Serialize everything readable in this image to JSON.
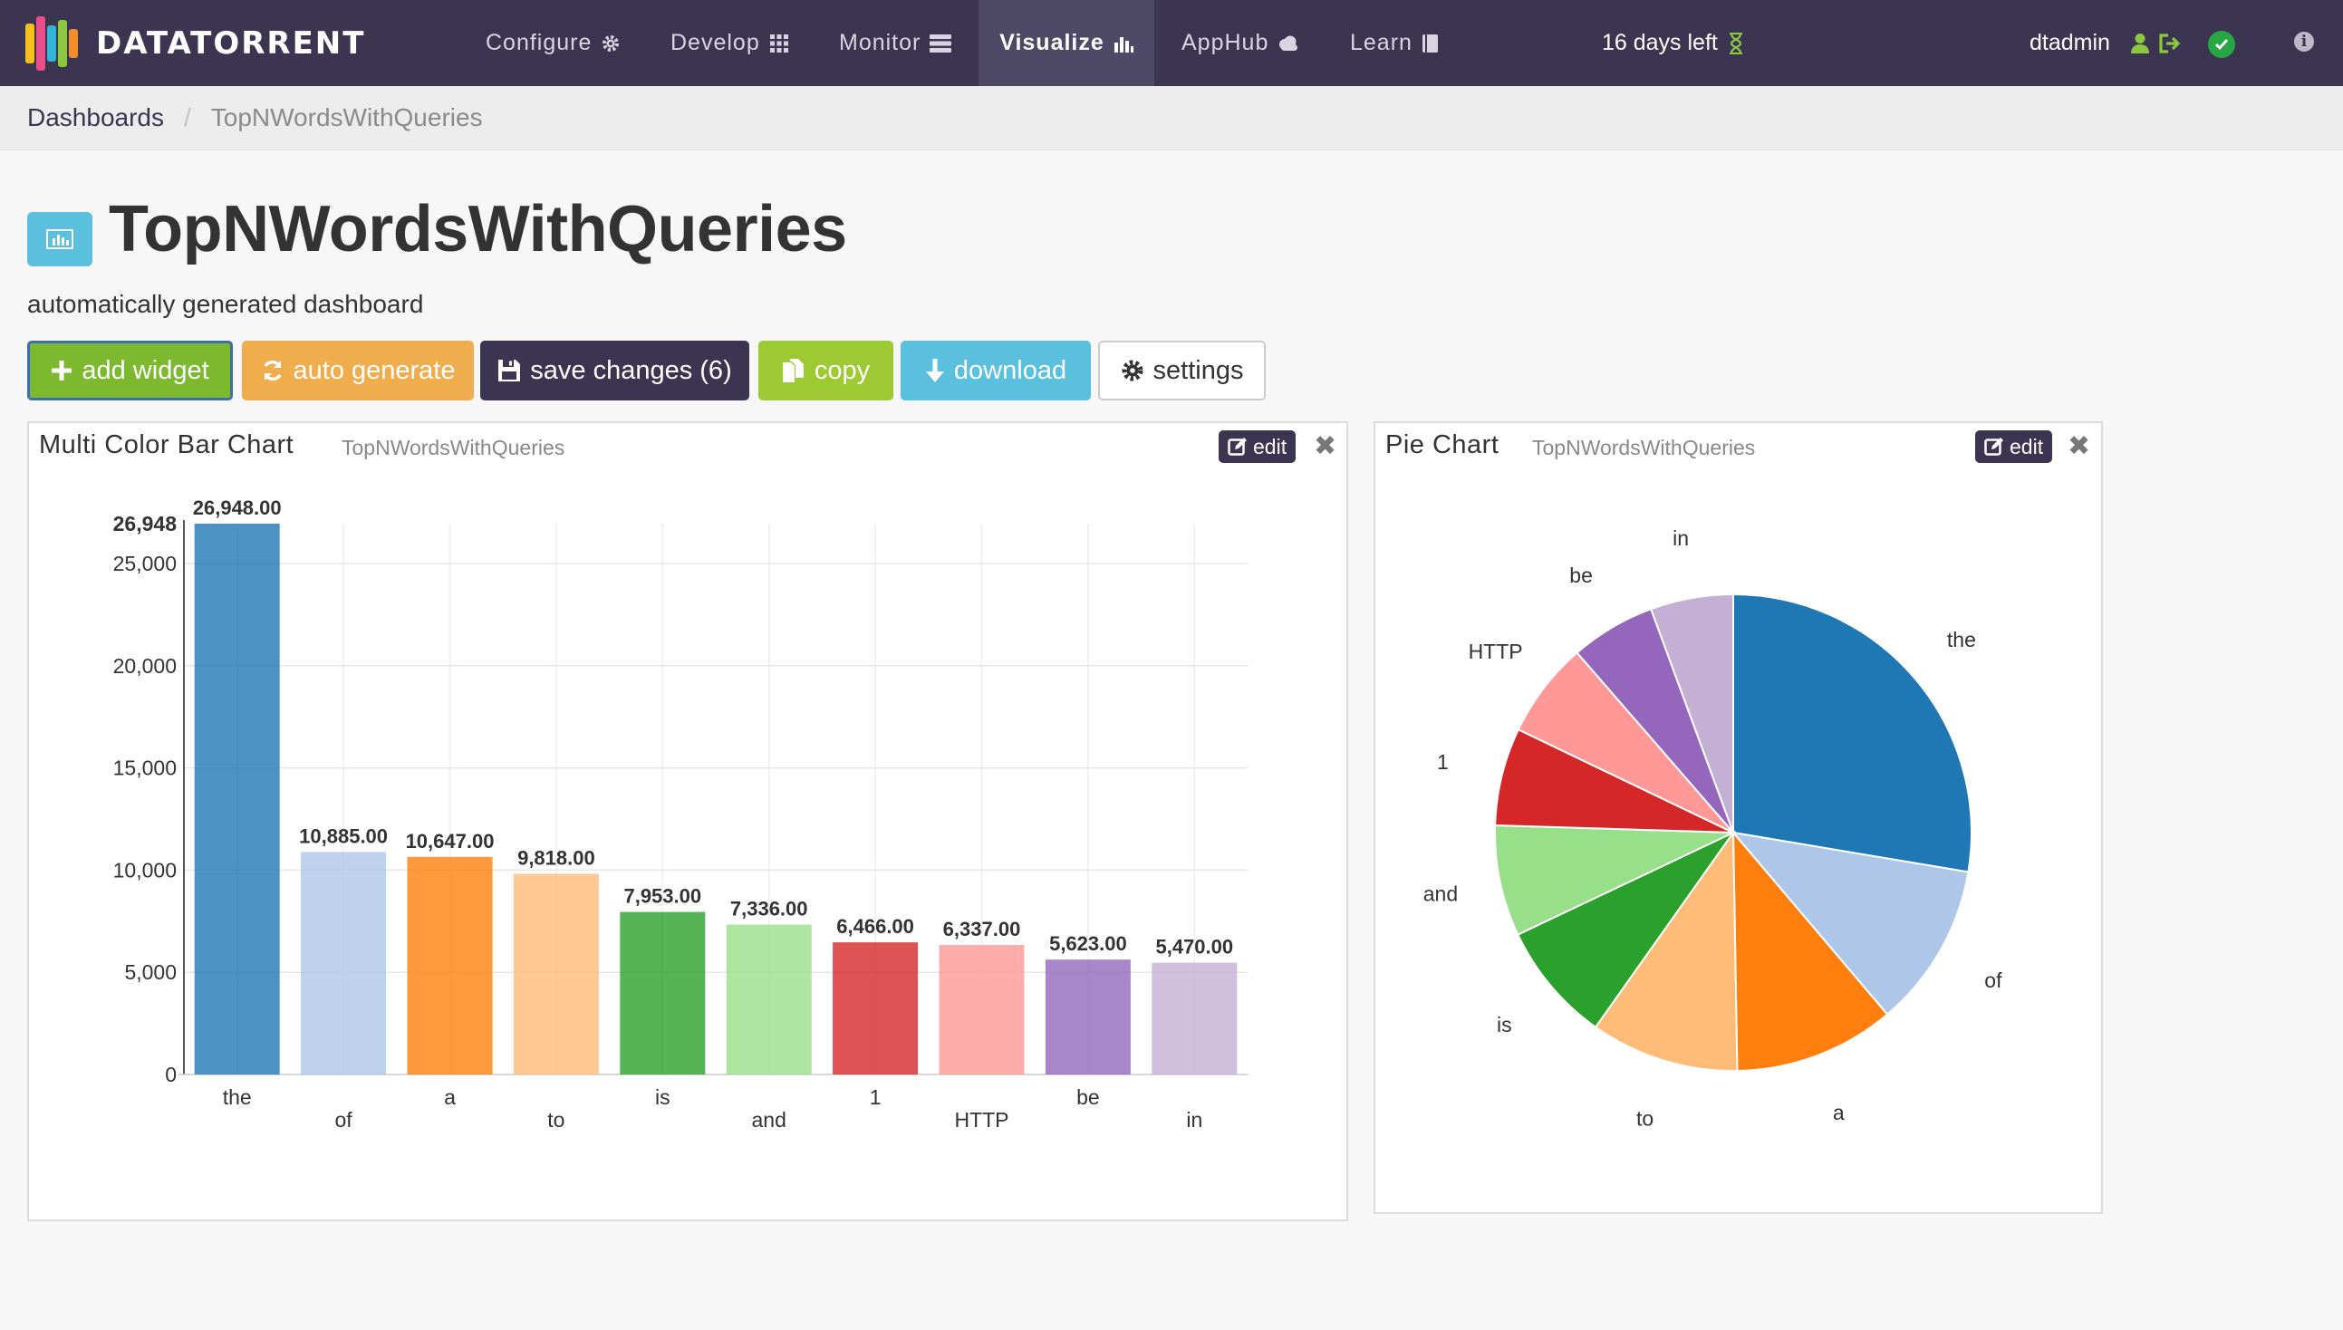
{
  "nav": {
    "brand": "DATATORRENT",
    "items": [
      {
        "label": "Configure",
        "icon": "gear-icon"
      },
      {
        "label": "Develop",
        "icon": "grid-icon"
      },
      {
        "label": "Monitor",
        "icon": "server-icon"
      },
      {
        "label": "Visualize",
        "icon": "bar-chart-icon",
        "active": true
      },
      {
        "label": "AppHub",
        "icon": "cloud-icon"
      },
      {
        "label": "Learn",
        "icon": "book-icon"
      }
    ],
    "trial": "16 days left",
    "user": "dtadmin"
  },
  "breadcrumb": {
    "root": "Dashboards",
    "separator": "/",
    "current": "TopNWordsWithQueries"
  },
  "page": {
    "title": "TopNWordsWithQueries",
    "subtitle": "automatically generated dashboard"
  },
  "toolbar": {
    "add_widget": "add widget",
    "auto_generate": "auto generate",
    "save_changes": "save changes (6)",
    "copy": "copy",
    "download": "download",
    "settings": "settings"
  },
  "widgets": {
    "bar": {
      "title": "Multi Color Bar Chart",
      "source": "TopNWordsWithQueries",
      "edit": "edit"
    },
    "pie": {
      "title": "Pie Chart",
      "source": "TopNWordsWithQueries",
      "edit": "edit"
    }
  },
  "colors": {
    "navbar": "#3b3551",
    "palette": [
      "#1f77b4",
      "#aec7e8",
      "#ff7f0e",
      "#ffbb78",
      "#2ca02c",
      "#98df8a",
      "#d62728",
      "#ff9896",
      "#9467bd",
      "#c5b0d5"
    ]
  },
  "chart_data": [
    {
      "type": "bar",
      "categories": [
        "the",
        "of",
        "a",
        "to",
        "is",
        "and",
        "1",
        "HTTP",
        "be",
        "in"
      ],
      "values": [
        26948,
        10885,
        10647,
        9818,
        7953,
        7336,
        6466,
        6337,
        5623,
        5470
      ],
      "data_labels": [
        "26,948.00",
        "10,885.00",
        "10,647.00",
        "9,818.00",
        "7,953.00",
        "7,336.00",
        "6,466.00",
        "6,337.00",
        "5,623.00",
        "5,470.00"
      ],
      "yticks": [
        0,
        5000,
        10000,
        15000,
        20000,
        25000
      ],
      "ytick_labels": [
        "0",
        "5,000",
        "10,000",
        "15,000",
        "20,000",
        "25,000"
      ],
      "ymax_label": "26,948",
      "ylim": [
        0,
        26948
      ],
      "grid": true
    },
    {
      "type": "pie",
      "categories": [
        "the",
        "of",
        "a",
        "to",
        "is",
        "and",
        "1",
        "HTTP",
        "be",
        "in"
      ],
      "values": [
        26948,
        10885,
        10647,
        9818,
        7953,
        7336,
        6466,
        6337,
        5623,
        5470
      ]
    }
  ]
}
